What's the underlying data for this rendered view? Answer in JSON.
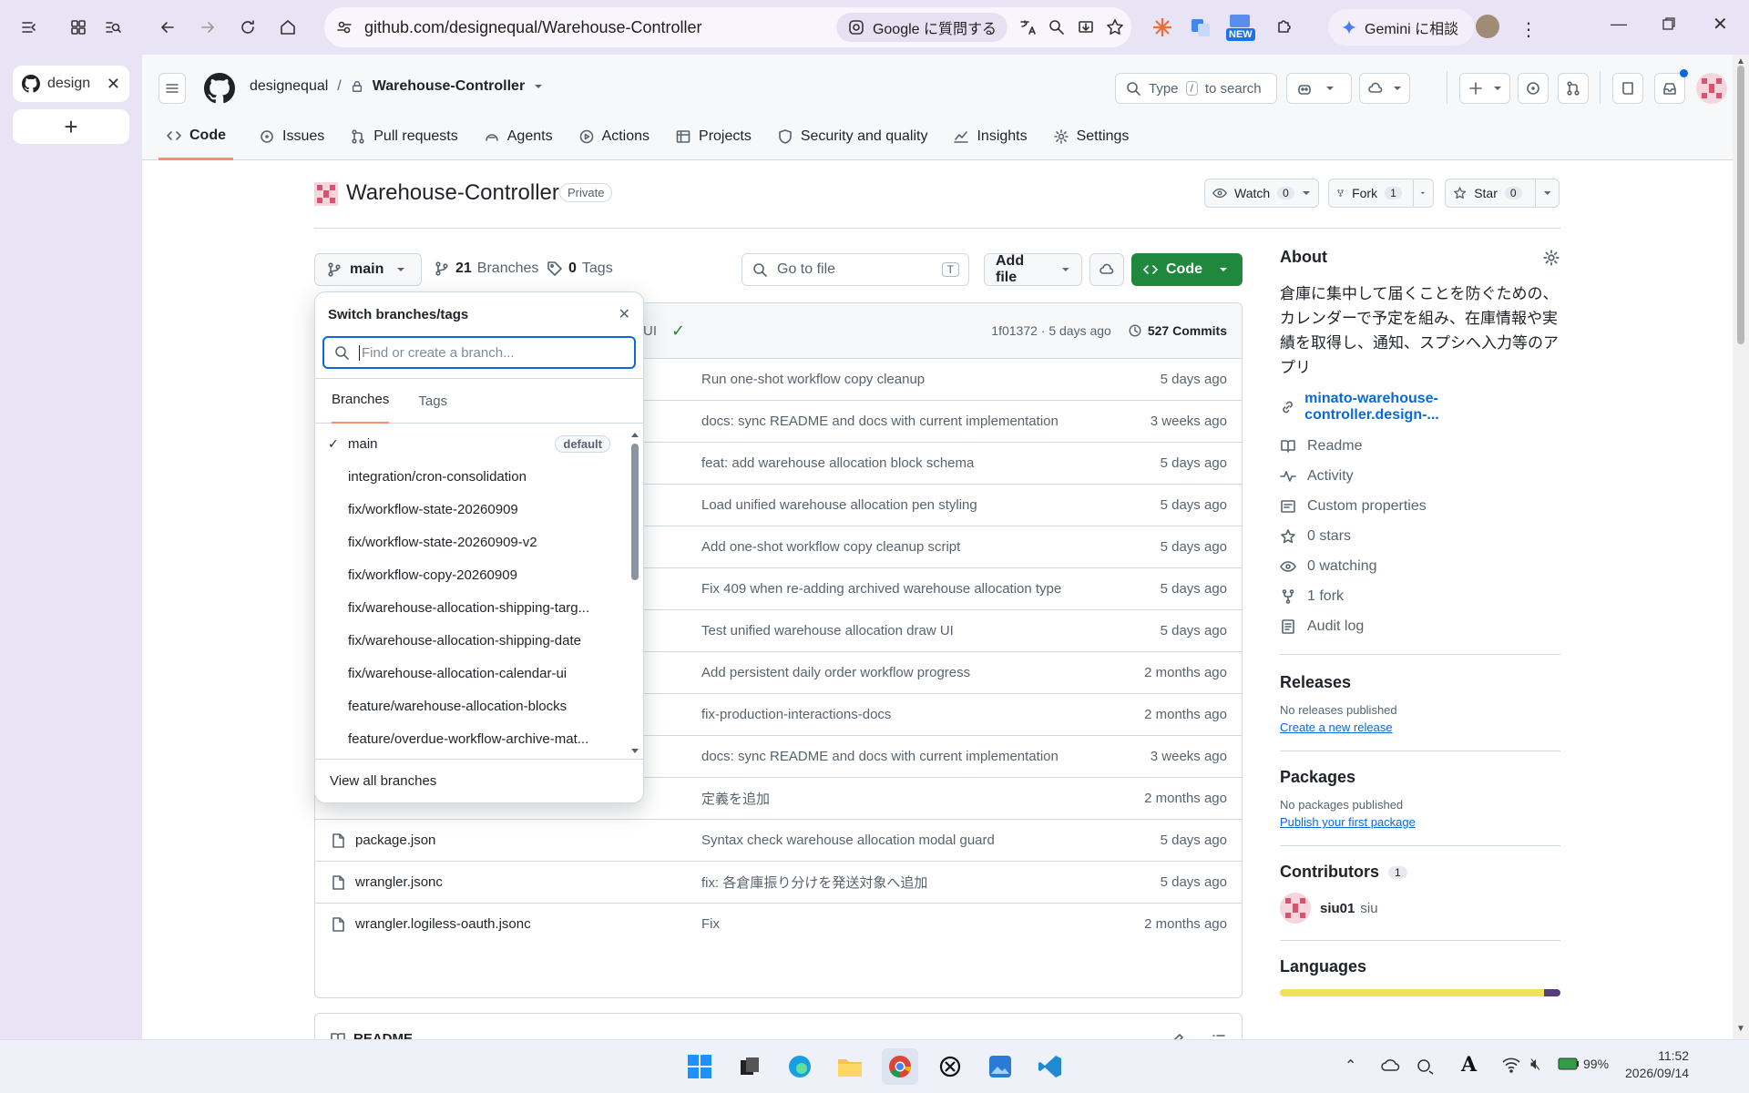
{
  "browser": {
    "tab_title": "design",
    "url": "github.com/designequal/Warehouse-Controller",
    "google_ask": "Google に質問する",
    "gemini": "Gemini に相談",
    "new_badge": "NEW"
  },
  "gh": {
    "owner": "designequal",
    "repo": "Warehouse-Controller",
    "search_placeholder_pre": "Type",
    "search_key": "/",
    "search_placeholder_post": "to search",
    "nav": [
      "Code",
      "Issues",
      "Pull requests",
      "Agents",
      "Actions",
      "Projects",
      "Security and quality",
      "Insights",
      "Settings"
    ],
    "repo_title": "Warehouse-Controller",
    "visibility": "Private",
    "watch": {
      "label": "Watch",
      "count": "0"
    },
    "fork": {
      "label": "Fork",
      "count": "1"
    },
    "star": {
      "label": "Star",
      "count": "0"
    }
  },
  "toolbar": {
    "branch": "main",
    "branches_count": "21",
    "branches_label": "Branches",
    "tags_count": "0",
    "tags_label": "Tags",
    "goto_placeholder": "Go to file",
    "goto_key": "T",
    "add_file": "Add file",
    "code": "Code"
  },
  "commit_bar": {
    "partial_msg": "UI",
    "hash": "1f01372",
    "age": "5 days ago",
    "commits": "527 Commits"
  },
  "files": [
    {
      "name": "",
      "msg": "Run one-shot workflow copy cleanup",
      "age": "5 days ago",
      "type": "hidden"
    },
    {
      "name": "",
      "msg": "docs: sync README and docs with current implementation",
      "age": "3 weeks ago",
      "type": "hidden"
    },
    {
      "name": "",
      "msg": "feat: add warehouse allocation block schema",
      "age": "5 days ago",
      "type": "hidden"
    },
    {
      "name": "",
      "msg": "Load unified warehouse allocation pen styling",
      "age": "5 days ago",
      "type": "hidden"
    },
    {
      "name": "",
      "msg": "Add one-shot workflow copy cleanup script",
      "age": "5 days ago",
      "type": "hidden"
    },
    {
      "name": "",
      "msg": "Fix 409 when re-adding archived warehouse allocation type",
      "age": "5 days ago",
      "type": "hidden"
    },
    {
      "name": "",
      "msg": "Test unified warehouse allocation draw UI",
      "age": "5 days ago",
      "type": "hidden"
    },
    {
      "name": "",
      "msg": "Add persistent daily order workflow progress",
      "age": "2 months ago",
      "type": "hidden"
    },
    {
      "name": "",
      "msg": "fix-production-interactions-docs",
      "age": "2 months ago",
      "type": "hidden"
    },
    {
      "name": "",
      "msg": "docs: sync README and docs with current implementation",
      "age": "3 weeks ago",
      "type": "hidden"
    },
    {
      "name": "",
      "msg": "定義を追加",
      "age": "2 months ago",
      "type": "hidden"
    },
    {
      "name": "package.json",
      "msg": "Syntax check warehouse allocation modal guard",
      "age": "5 days ago",
      "type": "file"
    },
    {
      "name": "wrangler.jsonc",
      "msg": "fix: 各倉庫振り分けを発送対象へ追加",
      "age": "5 days ago",
      "type": "file"
    },
    {
      "name": "wrangler.logiless-oauth.jsonc",
      "msg": "Fix",
      "age": "2 months ago",
      "type": "file"
    }
  ],
  "readme": {
    "title": "README"
  },
  "dropdown": {
    "title": "Switch branches/tags",
    "placeholder": "Find or create a branch...",
    "tab_branches": "Branches",
    "tab_tags": "Tags",
    "default_badge": "default",
    "branches": [
      "main",
      "integration/cron-consolidation",
      "fix/workflow-state-20260909",
      "fix/workflow-state-20260909-v2",
      "fix/workflow-copy-20260909",
      "fix/warehouse-allocation-shipping-targ...",
      "fix/warehouse-allocation-shipping-date",
      "fix/warehouse-allocation-calendar-ui",
      "feature/warehouse-allocation-blocks",
      "feature/overdue-workflow-archive-mat..."
    ],
    "view_all": "View all branches"
  },
  "about": {
    "title": "About",
    "description": "倉庫に集中して届くことを防ぐための、カレンダーで予定を組み、在庫情報や実績を取得し、通知、スプシへ入力等のアプリ",
    "website": "minato-warehouse-controller.design-...",
    "items": [
      "Readme",
      "Activity",
      "Custom properties",
      "0 stars",
      "0 watching",
      "1 fork",
      "Audit log"
    ]
  },
  "releases": {
    "title": "Releases",
    "none": "No releases published",
    "create": "Create a new release"
  },
  "packages": {
    "title": "Packages",
    "none": "No packages published",
    "publish": "Publish your first package"
  },
  "contributors": {
    "title": "Contributors",
    "count": "1",
    "user": "siu01",
    "name": "siu"
  },
  "languages": {
    "title": "Languages"
  },
  "taskbar": {
    "battery": "99%",
    "time": "11:52",
    "date": "2026/09/14"
  },
  "colors": {
    "green": "#1f883d",
    "link": "#0969da",
    "accent": "#fd8c73",
    "lang_js": "#f1e05a",
    "lang_other": "#563d7c"
  }
}
